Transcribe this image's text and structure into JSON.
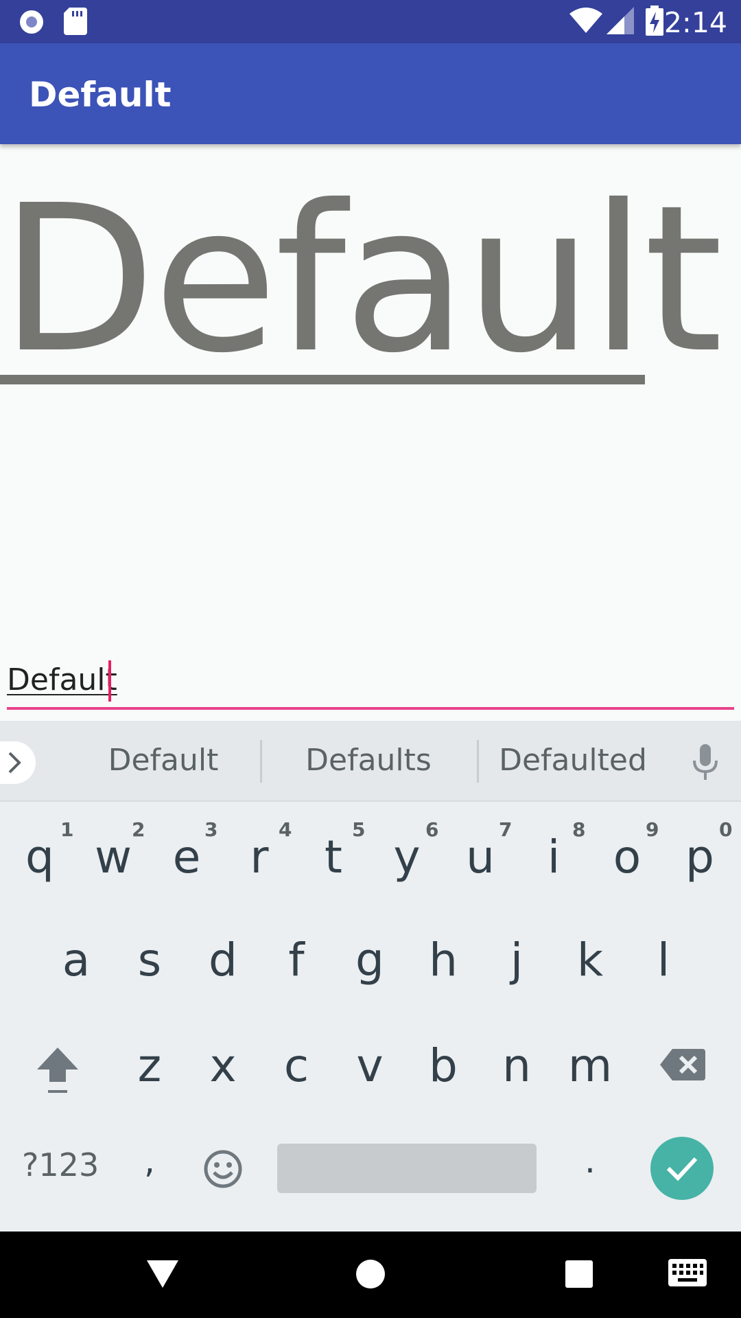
{
  "status_bar": {
    "time": "2:14"
  },
  "app_bar": {
    "title": "Default"
  },
  "content": {
    "large_text": "Default",
    "edit_field_value": "Default"
  },
  "keyboard": {
    "suggestions": [
      "Default",
      "Defaults",
      "Defaulted"
    ],
    "row1": [
      "q",
      "w",
      "e",
      "r",
      "t",
      "y",
      "u",
      "i",
      "o",
      "p"
    ],
    "row1_hints": [
      "1",
      "2",
      "3",
      "4",
      "5",
      "6",
      "7",
      "8",
      "9",
      "0"
    ],
    "row2": [
      "a",
      "s",
      "d",
      "f",
      "g",
      "h",
      "j",
      "k",
      "l"
    ],
    "row3": [
      "z",
      "x",
      "c",
      "v",
      "b",
      "n",
      "m"
    ],
    "symbols_label": "?123",
    "comma": ",",
    "period": "."
  },
  "colors": {
    "status_bar": "#34409a",
    "app_bar": "#3c53b7",
    "accent": "#e91e63",
    "enter_key": "#46b3a6"
  }
}
